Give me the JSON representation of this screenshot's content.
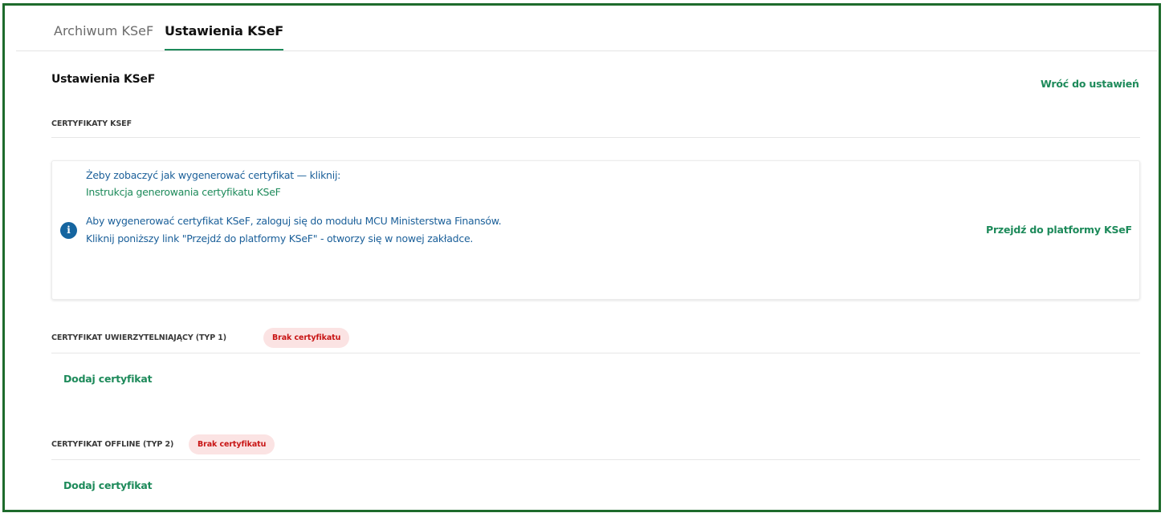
{
  "tabs": [
    {
      "label": "Archiwum KSeF",
      "active": false
    },
    {
      "label": "Ustawienia KSeF",
      "active": true
    }
  ],
  "page": {
    "title": "Ustawienia KSeF",
    "back_link": "Wróć do ustawień"
  },
  "certs_section": {
    "title": "CERTYFIKATY KSEF"
  },
  "info": {
    "line1": "Żeby zobaczyć jak wygenerować certyfikat — kliknij:",
    "instruction_link": "Instrukcja generowania certyfikatu KSeF",
    "line3": "Aby wygenerować certyfikat KSeF, zaloguj się do modułu MCU Ministerstwa Finansów.",
    "line4": "Kliknij poniższy link \"Przejdź do platformy KSeF\" - otworzy się w nowej zakładce.",
    "platform_link": "Przejdź do platformy KSeF"
  },
  "cert_auth": {
    "title": "CERTYFIKAT UWIERZYTELNIAJĄCY (TYP 1)",
    "status": "Brak certyfikatu",
    "add_label": "Dodaj certyfikat"
  },
  "cert_offline": {
    "title": "CERTYFIKAT OFFLINE (TYP 2)",
    "status": "Brak certyfikatu",
    "add_label": "Dodaj certyfikat"
  },
  "colors": {
    "accent": "#1d8a5a",
    "info_text": "#1a5f99",
    "badge_bg": "#fbe3e3",
    "badge_text": "#c81414",
    "frame": "#1e6b2c"
  },
  "icons": {
    "info": "info-icon"
  }
}
